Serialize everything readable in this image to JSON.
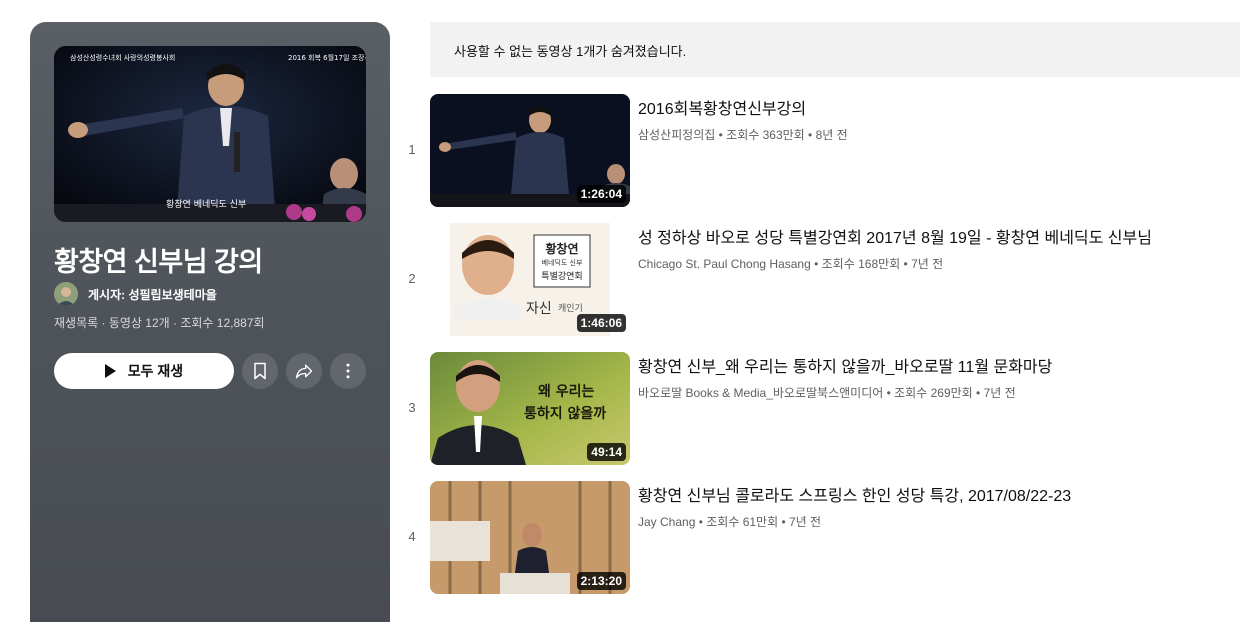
{
  "playlist": {
    "title": "황창연 신부님 강의",
    "owner": "게시자: 성필립보생테마을",
    "meta": "재생목록 · 동영상 12개 · 조회수 12,887회",
    "play_all_label": "모두 재생",
    "hero_caption_left": "삼성산성령수녀회 사랑의성령봉사회",
    "hero_caption_right": "2016 회복 6월17일 조장강의1",
    "hero_name": "황창연 베네딕도 신부"
  },
  "notice": "사용할 수 없는 동영상 1개가 숨겨졌습니다.",
  "videos": [
    {
      "index": "1",
      "title": "2016회복황창연신부강의",
      "meta": "삼성산피정의집 • 조회수 363만회 • 8년 전",
      "duration": "1:26:04"
    },
    {
      "index": "2",
      "title": "성 정하상 바오로 성당 특별강연회 2017년 8월 19일 - 황창연 베네딕도 신부님",
      "meta": "Chicago St. Paul Chong Hasang • 조회수 168만회 • 7년 전",
      "duration": "1:46:06",
      "thumb_text": [
        "황창연",
        "베네딕도 신부",
        "특별강연회",
        "자신",
        "캐인기"
      ]
    },
    {
      "index": "3",
      "title": "황창연 신부_왜 우리는 통하지 않을까_바오로딸 11월 문화마당",
      "meta": "바오로딸 Books & Media_바오로딸북스앤미디어 • 조회수 269만회 • 7년 전",
      "duration": "49:14",
      "thumb_text": [
        "왜 우리는",
        "통하지 않을까"
      ]
    },
    {
      "index": "4",
      "title": "황창연 신부님 콜로라도 스프링스 한인 성당 특강, 2017/08/22-23",
      "meta": "Jay Chang • 조회수 61만회 • 7년 전",
      "duration": "2:13:20"
    }
  ],
  "icons": {
    "save": "bookmark-icon",
    "share": "share-icon",
    "more": "more-vert-icon",
    "play": "play-icon"
  }
}
